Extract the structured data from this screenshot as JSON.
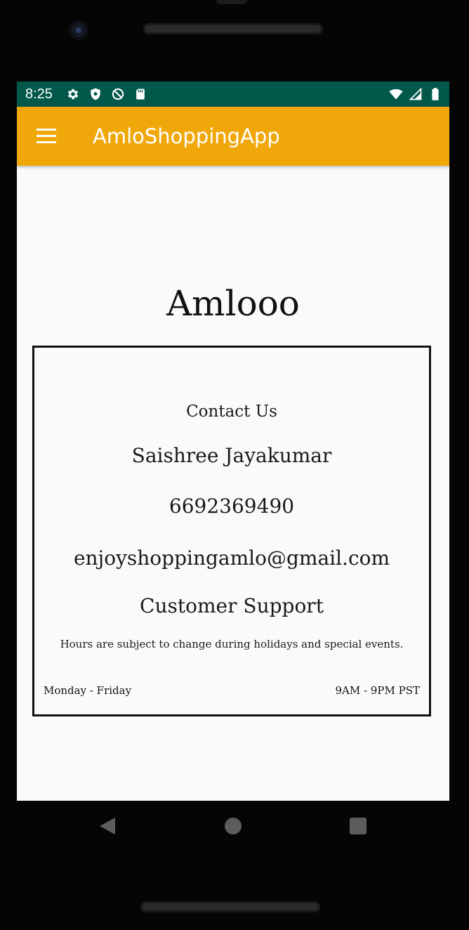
{
  "status_bar": {
    "time": "8:25",
    "left_icons": [
      "settings-icon",
      "shield-icon",
      "no-disturb-icon",
      "sd-card-icon"
    ],
    "right_icons": [
      "wifi-icon",
      "signal-icon",
      "battery-icon"
    ],
    "background": "#02584a"
  },
  "app_bar": {
    "title": "AmloShoppingApp",
    "menu_icon": "hamburger-menu-icon",
    "background": "#f0a70a"
  },
  "main": {
    "brand": "Amlooo",
    "contact": {
      "heading": "Contact Us",
      "name": "Saishree Jayakumar",
      "phone": "6692369490",
      "email": "enjoyshoppingamlo@gmail.com",
      "support_heading": "Customer Support",
      "hours_note": "Hours are subject to change during holidays and special events.",
      "days": "Monday - Friday",
      "hours": "9AM - 9PM PST"
    }
  },
  "nav_bar": {
    "buttons": [
      "back-icon",
      "home-icon",
      "recents-icon"
    ]
  }
}
